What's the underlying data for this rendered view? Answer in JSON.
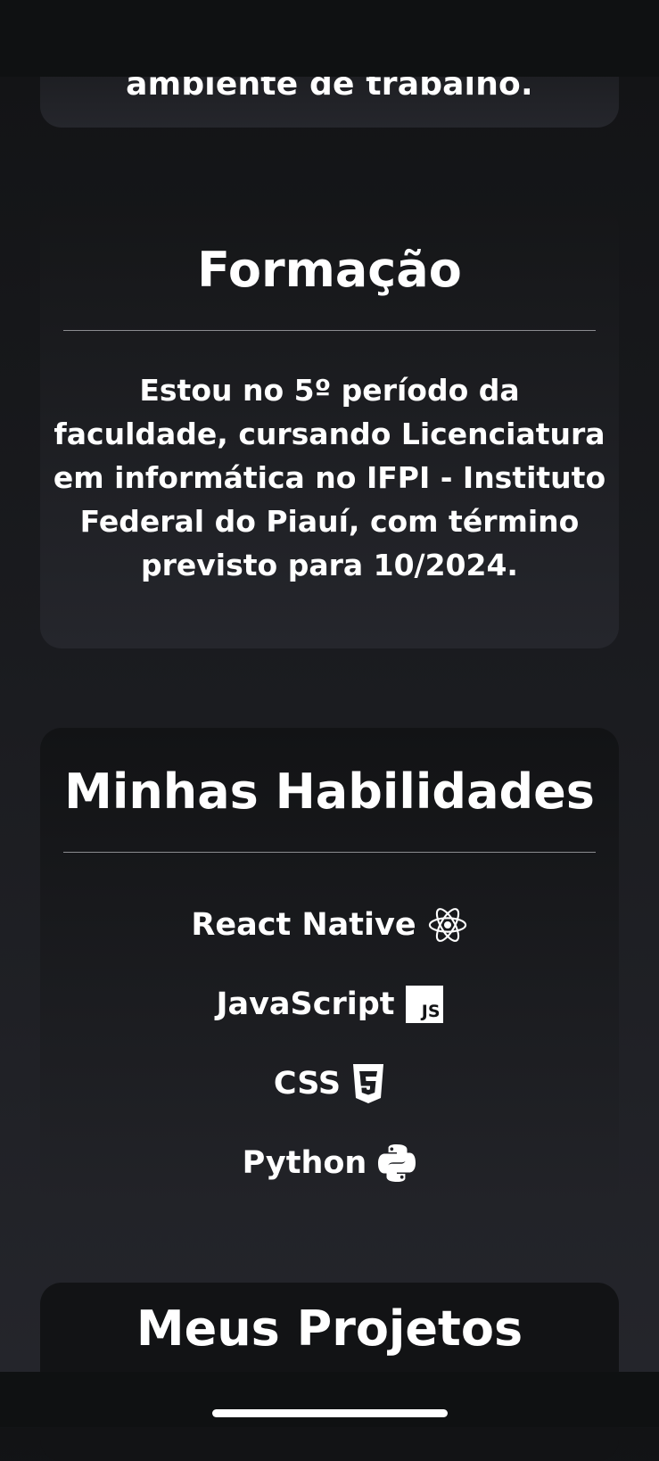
{
  "top_card": {
    "partial_text": "ambiente de trabalho."
  },
  "formacao": {
    "title": "Formação",
    "text": "Estou no 5º período da faculdade, cursando Licenciatura em informática no IFPI - Instituto Federal do Piauí, com término previsto para 10/2024."
  },
  "habilidades": {
    "title": "Minhas Habilidades",
    "skills": [
      {
        "label": "React Native",
        "icon": "react-icon"
      },
      {
        "label": "JavaScript",
        "icon": "javascript-icon"
      },
      {
        "label": "CSS",
        "icon": "css3-icon"
      },
      {
        "label": "Python",
        "icon": "python-icon"
      }
    ],
    "js_badge_text": "JS"
  },
  "projetos": {
    "title": "Meus Projetos"
  }
}
